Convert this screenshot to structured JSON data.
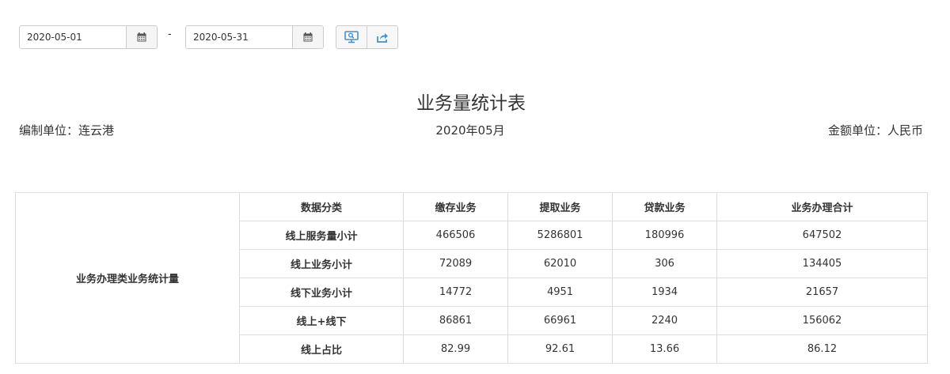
{
  "toolbar": {
    "start_date": "2020-05-01",
    "end_date": "2020-05-31",
    "separator": "-"
  },
  "report": {
    "title": "业务量统计表",
    "unit_label": "编制单位：连云港",
    "period": "2020年05月",
    "currency_label": "金额单位：人民币"
  },
  "table": {
    "group_label": "业务办理类业务统计量",
    "headers": [
      "数据分类",
      "缴存业务",
      "提取业务",
      "贷款业务",
      "业务办理合计"
    ],
    "rows": [
      {
        "label": "线上服务量小计",
        "deposit": "466506",
        "withdraw": "5286801",
        "loan": "180996",
        "total": "647502"
      },
      {
        "label": "线上业务小计",
        "deposit": "72089",
        "withdraw": "62010",
        "loan": "306",
        "total": "134405"
      },
      {
        "label": "线下业务小计",
        "deposit": "14772",
        "withdraw": "4951",
        "loan": "1934",
        "total": "21657"
      },
      {
        "label": "线上+线下",
        "deposit": "86861",
        "withdraw": "66961",
        "loan": "2240",
        "total": "156062"
      },
      {
        "label": "线上占比",
        "deposit": "82.99",
        "withdraw": "92.61",
        "loan": "13.66",
        "total": "86.12"
      }
    ]
  },
  "icons": {
    "calendar": "calendar-icon",
    "preview": "monitor-preview-icon",
    "export": "share-export-icon"
  },
  "colors": {
    "icon_blue": "#4a90c8",
    "border": "#dddddd",
    "text": "#333333"
  }
}
